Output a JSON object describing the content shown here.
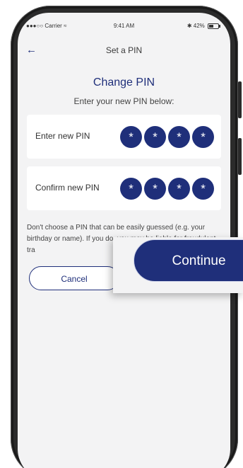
{
  "status_bar": {
    "carrier": "●●●○○ Carrier",
    "wifi_icon": "wifi-icon",
    "time": "9:41 AM",
    "bluetooth_icon": "bluetooth-icon",
    "battery_percent": "42%"
  },
  "nav": {
    "back_icon": "back-arrow-icon",
    "back_glyph": "←",
    "title": "Set a PIN"
  },
  "heading": "Change PIN",
  "subheading": "Enter your new PIN below:",
  "new_pin": {
    "label": "Enter new PIN",
    "digits": [
      "*",
      "*",
      "*",
      "*"
    ]
  },
  "confirm_pin": {
    "label": "Confirm new PIN",
    "digits": [
      "*",
      "*",
      "*",
      "*"
    ]
  },
  "warning_text": "Don't choose a PIN that can be easily guessed (e.g. your birthday or name). If you do, you may be liable for fraudulent tra",
  "buttons": {
    "cancel": "Cancel",
    "continue": "Continue"
  },
  "colors": {
    "brand": "#1f2f7a",
    "screen_bg": "#f3f3f4",
    "card_bg": "#ffffff"
  }
}
